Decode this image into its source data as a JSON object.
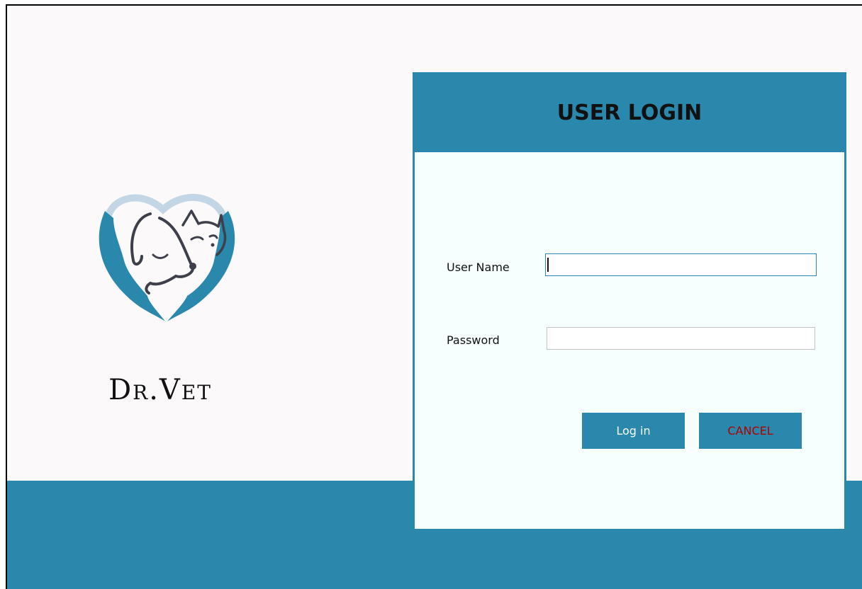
{
  "brand": {
    "name": "Dr.Vet",
    "logo_icon": "heart-hands-dog-cat-icon"
  },
  "login": {
    "title": "USER LOGIN",
    "username_label": "User Name",
    "username_value": "",
    "password_label": "Password",
    "password_value": "",
    "login_label": "Log in",
    "cancel_label": "CANCEL"
  },
  "colors": {
    "accent": "#2a88ad",
    "background": "#fbf9f9",
    "card_background": "#f7fefe",
    "cancel_text": "#b00000"
  }
}
